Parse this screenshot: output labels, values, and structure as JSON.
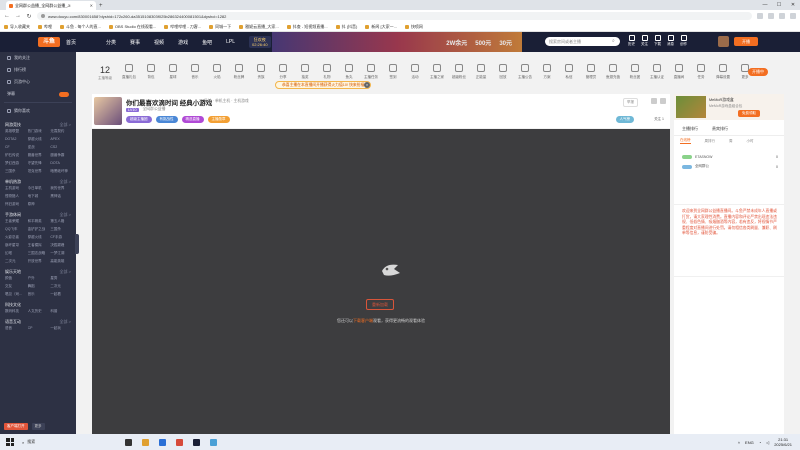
{
  "browser": {
    "tab_title": "全网群公益播_全网群公益播_Ji",
    "url": "www.douyu.com/830001658?dyshid=172c260-da3515108303f025b286324400081501&dyshci=1282",
    "bookmarks": [
      "导入收藏夹",
      "哔哩",
      "斗鱼 - 每个人的直...",
      "OBS Studio 在线观看...",
      "哔哩哔哩 - 刀客...",
      "同城一下",
      "雅妮云直播_大家...",
      "抖查 - 短视频直播...",
      "抖 (抖音)",
      "新闻 [大家一...",
      "快喷网"
    ]
  },
  "site_header": {
    "logo": "斗鱼",
    "home": "首页",
    "nav": [
      "分类",
      "赛事",
      "视频",
      "游戏",
      "鱼吧",
      "LPL"
    ],
    "promo_label": "狂欢夜",
    "promo_time": "02:26:40",
    "banner_texts": [
      "2W余元",
      "500元",
      "30元"
    ],
    "search_placeholder": "搜索房间或者主播",
    "icons": [
      "历史",
      "关注",
      "下载",
      "消息",
      "创作"
    ],
    "live_button": "开播"
  },
  "sidebar": {
    "top_items": [
      "我的关注",
      "排行榜",
      "页游中心"
    ],
    "toggle_label": "弹幕",
    "recommend_label": "猜你喜欢",
    "sections": [
      {
        "title": "网游竞技",
        "more": "全部 >",
        "items": [
          "英雄联盟",
          "热门游戏",
          "无畏契约",
          "DOTA2",
          "穿越火线",
          "APEX",
          "CF",
          "逆战",
          "CS2",
          "炉石传说",
          "魔兽世界",
          "魔兽争霸",
          "梦幻西游",
          "守望先锋",
          "DOTA",
          "三国杀",
          "坦克世界",
          "暗黑破坏神"
        ]
      },
      {
        "title": "单机热游",
        "more": "全部 >",
        "items": [
          "主机游戏",
          "今日单机",
          "我的世界",
          "怪物猎人",
          "地下城",
          "黑神话",
          "怀旧游戏",
          "原神"
        ]
      },
      {
        "title": "手游休闲",
        "more": "全部 >",
        "items": [
          "王者荣耀",
          "和平精英",
          "第五人格",
          "QQ飞车",
          "金铲铲之战",
          "三国杀",
          "火影忍者",
          "穿越火线",
          "CF手游",
          "崩坏星穹",
          "王者模拟",
          "决胜巅峰",
          "幻塔",
          "三国志战略",
          "一梦江湖",
          "二次元",
          "开放世界",
          "高能英雄"
        ]
      },
      {
        "title": "娱乐天地",
        "more": "全部 >",
        "items": [
          "颜值",
          "户外",
          "星秀",
          "交友",
          "舞蹈",
          "二次元",
          "唱见（戏...",
          "音乐",
          "一起看"
        ]
      },
      {
        "title": "科技文化",
        "more": "",
        "items": [
          "数码科技",
          "人文历史",
          "科普"
        ]
      },
      {
        "title": "语音互动",
        "more": "全部 >",
        "items": [
          "语音",
          "CP",
          "一起玩"
        ]
      }
    ],
    "bottom_buttons": [
      "客户端打开",
      "更多"
    ]
  },
  "toolbar": {
    "first_value": "12",
    "first_label": "主播等级",
    "items": [
      "直播礼包",
      "背包",
      "星球",
      "音乐",
      "火焰",
      "粉丝牌",
      "贵族",
      "分享",
      "抽奖",
      "礼物",
      "鱼丸",
      "主播任务",
      "签到",
      "活动",
      "主播之家",
      "超级粉丝",
      "正能量",
      "回放",
      "主播公告",
      "方案",
      "私信",
      "管理员",
      "鱼翅充值",
      "粉丝团",
      "主播认证",
      "直播间",
      "任务",
      "弹幕设置",
      "更多"
    ],
    "right_button": "开播中"
  },
  "toast": {
    "text": "恭喜主播在本直播间开播获得火力值10! 快来抢福利"
  },
  "anchor": {
    "title": "你们最喜欢滴时间 经典小游戏",
    "category": "导航 · 单机主机 · 主机游戏",
    "level": "LV10",
    "name": "全网群公益播",
    "tags": [
      "超级主播团",
      "有挑战性",
      "精选直播",
      "主播勋章"
    ],
    "report": "举报",
    "rank": "人气榜",
    "follow_label": "关注",
    "follow_count": "1"
  },
  "player": {
    "retry_button": "重新加载",
    "message_prefix": "您还可以",
    "message_link": "下载客户端",
    "message_suffix": "观看，获得更流畅的观看体验"
  },
  "right_panel": {
    "ad_title": "MeMoR游戏盒",
    "ad_sub": "MeMoR游戏盒组合包",
    "ad_button": "免费领取",
    "tabs": [
      "主播排行",
      "贵宾排行"
    ],
    "subtabs": [
      "在线榜",
      "周排行",
      "周",
      "小时"
    ],
    "rows": [
      {
        "name": "ETASNOW",
        "value": "0"
      },
      {
        "name": "全网群公",
        "value": "0"
      }
    ],
    "notice": "欢迎来到全网群公益播直播间。斗鱼严禁未成年人直播或打赏，请大家理性消费。直播内容和评论严禁出现违法违规、低俗色情、吸烟酗酒等内容，若有违反，将视情节严重程度对直播间进行处罚。请勿相信各类刷量、兼职、刷单等信息，谨防受骗。"
  },
  "taskbar": {
    "search": "搜索",
    "tray_lang": "ENG",
    "time": "21:31",
    "date": "2025/6/21"
  }
}
